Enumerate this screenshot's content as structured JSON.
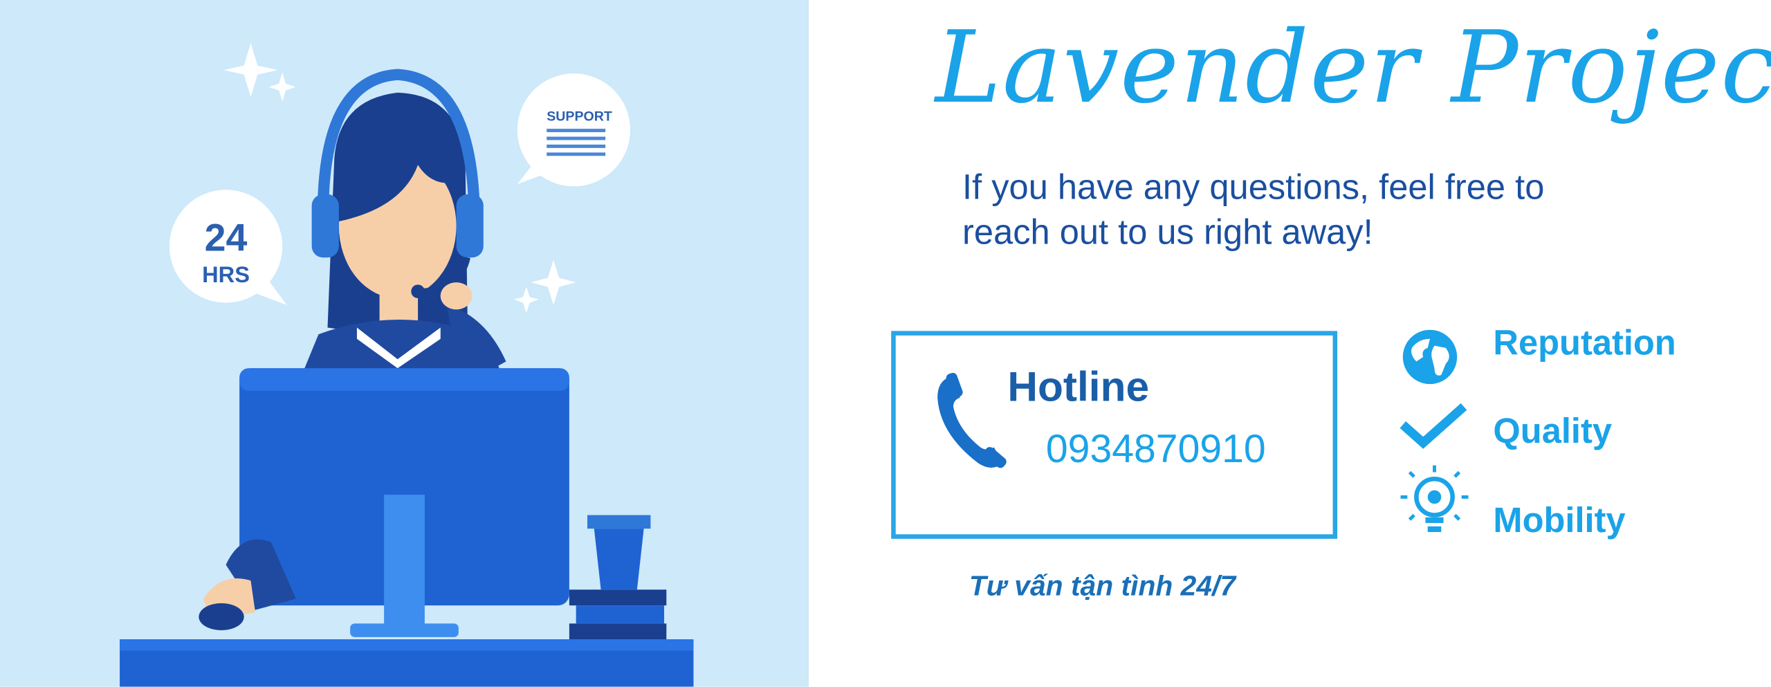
{
  "brand": {
    "title": "Lavender Project"
  },
  "intro": {
    "line1": "If you have any questions, feel free to",
    "line2": "reach out to us right away!"
  },
  "hotline": {
    "label": "Hotline",
    "number": "0934870910"
  },
  "tagline": "Tư vấn tận tình 24/7",
  "features": [
    {
      "label": "Reputation",
      "icon": "globe-icon"
    },
    {
      "label": "Quality",
      "icon": "checkmark-icon"
    },
    {
      "label": "Mobility",
      "icon": "lightbulb-gear-icon"
    }
  ],
  "illustration": {
    "support_bubble": "SUPPORT",
    "hours_bubble_number": "24",
    "hours_bubble_unit": "HRS"
  },
  "colors": {
    "accent": "#1aa3e8",
    "dark_blue": "#1a4fa0",
    "illustration_bg": "#cde9fa"
  }
}
